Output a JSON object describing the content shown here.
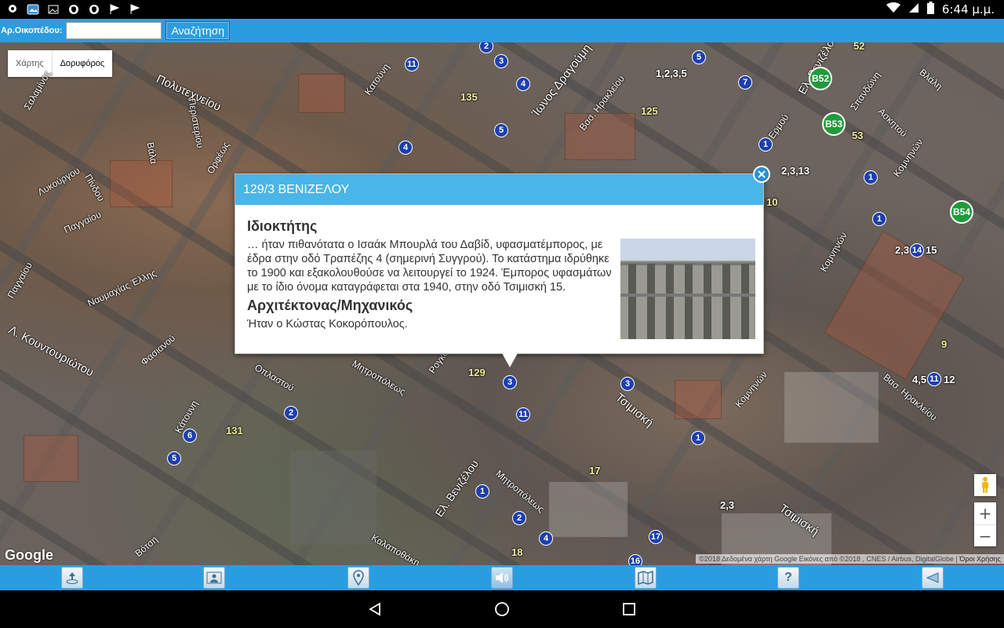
{
  "status_bar": {
    "time": "6:44 μ.μ."
  },
  "search": {
    "label": "Αρ.Οικοπέδου:",
    "value": "",
    "placeholder": "",
    "button_label": "Αναζήτηση"
  },
  "map": {
    "type_buttons": [
      "Χάρτης",
      "Δορυφόρος"
    ],
    "active_type": "Δορυφόρος",
    "google_logo": "Google",
    "attribution": "©2018 Δεδομένα χάρτη Google Εικόνες από ©2018 , CNES / Airbus, DigitalGlobe",
    "terms": "Όροι Χρήσης",
    "zoom_in": "+",
    "zoom_out": "−",
    "streets": [
      "Πολυτεχνείου",
      "Σαλαμίνος",
      "Κατούνη",
      "Ίωνος Δραγούμη",
      "Βασ. Ηρακλείου",
      "Ερμού",
      "Ελ. Βενιζέλου",
      "Σπανδώνη",
      "Ασκητού",
      "Βλάλη",
      "Κομνηνών",
      "Λυκούργου",
      "Βάλα",
      "Ορφέως",
      "Περιστερίου",
      "Παγγαίου",
      "Πίνδου",
      "Ναυμαχίας Έλλης",
      "Παγγαίου",
      "Λ. Κουντουριώτου",
      "Φασιανού",
      "Οπλαστού",
      "Μητροπόλεως",
      "Τσιμισκή",
      "Κομνηνών",
      "Ελ. Βενιζέλου",
      "Μητροπόλεως",
      "Τσιμισκή",
      "Βασ. Ηρακλείου",
      "Καλαποθάκη",
      "Ρογκότη",
      "Βότση",
      "Κομνηνών",
      "Κάτουνη"
    ],
    "markers_blue": [
      "2",
      "11",
      "3",
      "4",
      "5",
      "4",
      "1,2,3,5",
      "5",
      "7",
      "1",
      "2,3,13",
      "1",
      "1",
      "2,3",
      "14",
      "15",
      "3",
      "11",
      "3",
      "2",
      "6",
      "5",
      "1",
      "2",
      "4",
      "1",
      "2,3",
      "17",
      "16",
      "4,5",
      "11",
      "12"
    ],
    "markers_green": [
      "B52",
      "B53",
      "B54"
    ],
    "plot_numbers": [
      "135",
      "125",
      "52",
      "53",
      "10",
      "129",
      "131",
      "17",
      "18",
      "9"
    ]
  },
  "info_window": {
    "title": "129/3 ΒΕΝΙΖΕΛΟΥ",
    "section1_heading": "Ιδιοκτήτης",
    "section1_text": "… ήταν πιθανότατα ο Ισαάκ Μπουρλά του Δαβίδ, υφασματέμπορος, με έδρα στην οδό Τραπέζης 4 (σημερινή Συγγρού). Το κατάστημα ιδρύθηκε το 1900 και εξακολουθούσε να λειτουργεί το 1924. Έμπορος υφασμάτων με το ίδιο όνομα καταγράφεται στα 1940, στην οδό Τσιμισκή 15.",
    "section2_heading": "Αρχιτέκτονας/Μηχανικός",
    "section2_text": "Ήταν ο Κώστας Κοκορόπουλος."
  },
  "toolbar": {
    "buttons": [
      "upload-icon",
      "person-map-icon",
      "location-pin-icon",
      "sound-icon",
      "map-book-icon",
      "help-icon",
      "back-icon"
    ],
    "help_label": "?"
  }
}
